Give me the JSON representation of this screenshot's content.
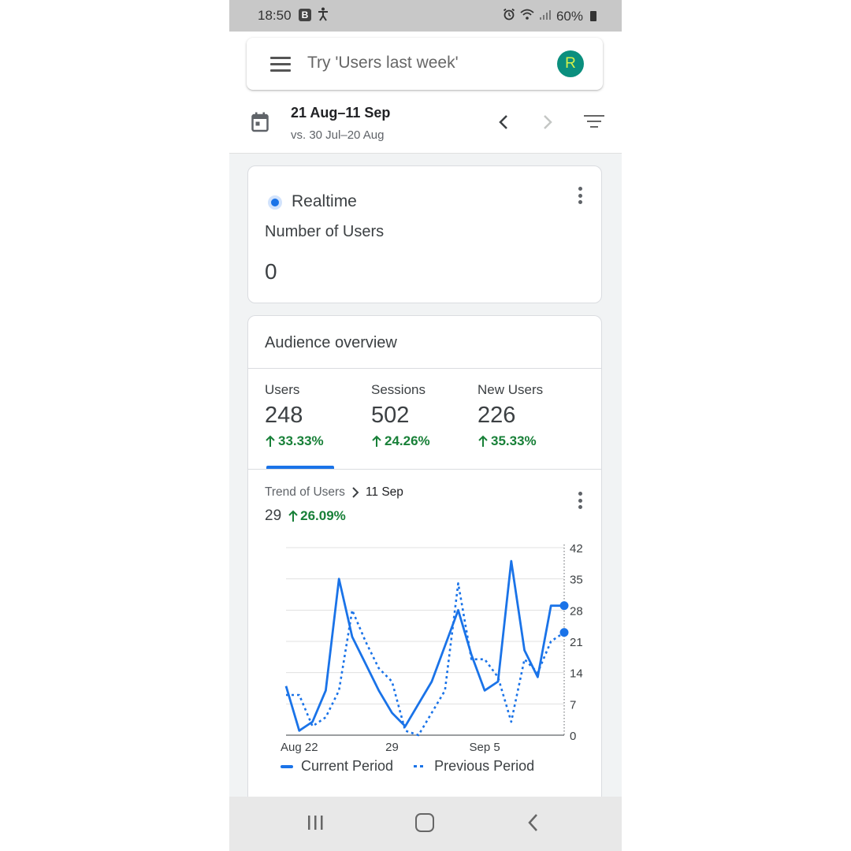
{
  "status_bar": {
    "time": "18:50",
    "notif_badge": "B",
    "battery": "60%"
  },
  "search": {
    "placeholder": "Try 'Users last week'",
    "avatar_letter": "R"
  },
  "date_range": {
    "main": "21 Aug–11 Sep",
    "compare": "vs. 30 Jul–20 Aug"
  },
  "realtime": {
    "title": "Realtime",
    "subtitle": "Number of Users",
    "value": "0"
  },
  "audience": {
    "title": "Audience overview",
    "metrics": [
      {
        "label": "Users",
        "value": "248",
        "change": "33.33%"
      },
      {
        "label": "Sessions",
        "value": "502",
        "change": "24.26%"
      },
      {
        "label": "New Users",
        "value": "226",
        "change": "35.33%"
      }
    ],
    "trend": {
      "crumb_first": "Trend of Users",
      "crumb_last": "11 Sep",
      "value": "29",
      "change": "26.09%"
    },
    "legend": {
      "current": "Current Period",
      "previous": "Previous Period"
    }
  },
  "colors": {
    "accent": "#1a73e8",
    "positive": "#188038"
  },
  "chart_data": {
    "type": "line",
    "x": [
      "Aug 21",
      "Aug 22",
      "Aug 23",
      "Aug 24",
      "Aug 25",
      "Aug 26",
      "Aug 27",
      "Aug 28",
      "Aug 29",
      "Aug 30",
      "Aug 31",
      "Sep 1",
      "Sep 2",
      "Sep 3",
      "Sep 4",
      "Sep 5",
      "Sep 6",
      "Sep 7",
      "Sep 8",
      "Sep 9",
      "Sep 10",
      "Sep 11"
    ],
    "x_tick_labels": [
      {
        "index": 1,
        "label": "Aug 22"
      },
      {
        "index": 8,
        "label": "29"
      },
      {
        "index": 15,
        "label": "Sep 5"
      }
    ],
    "series": [
      {
        "name": "Current Period",
        "style": "solid",
        "values": [
          11,
          1,
          3,
          10,
          35,
          22,
          16,
          10,
          5,
          2,
          7,
          12,
          20,
          28,
          18,
          10,
          12,
          39,
          19,
          13,
          29,
          29
        ]
      },
      {
        "name": "Previous Period",
        "style": "dotted",
        "values": [
          9,
          9,
          2,
          4,
          10,
          28,
          21,
          15,
          12,
          1,
          0,
          5,
          10,
          34,
          17,
          17,
          13,
          3,
          17,
          14,
          21,
          23
        ]
      }
    ],
    "y_ticks": [
      0,
      7,
      14,
      21,
      28,
      35,
      42
    ],
    "ylim": [
      0,
      42
    ],
    "y_axis_position": "right",
    "grid": true
  }
}
